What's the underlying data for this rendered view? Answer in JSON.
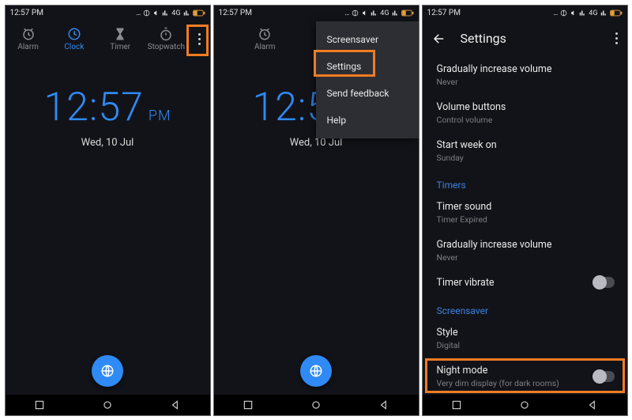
{
  "status": {
    "time": "12:57 PM",
    "net": "4G",
    "extra": "…"
  },
  "tabs": {
    "alarm": "Alarm",
    "clock": "Clock",
    "timer": "Timer",
    "stopwatch": "Stopwatch"
  },
  "clock": {
    "time": "12:57",
    "ampm": "PM",
    "date": "Wed, 10 Jul"
  },
  "menu": {
    "screensaver": "Screensaver",
    "settings": "Settings",
    "feedback": "Send feedback",
    "help": "Help"
  },
  "settings": {
    "title": "Settings",
    "giv": {
      "t": "Gradually increase volume",
      "s": "Never"
    },
    "vol": {
      "t": "Volume buttons",
      "s": "Control volume"
    },
    "week": {
      "t": "Start week on",
      "s": "Sunday"
    },
    "sec_timers": "Timers",
    "tsound": {
      "t": "Timer sound",
      "s": "Timer Expired"
    },
    "giv2": {
      "t": "Gradually increase volume",
      "s": "Never"
    },
    "tvib": {
      "t": "Timer vibrate"
    },
    "sec_ss": "Screensaver",
    "style": {
      "t": "Style",
      "s": "Digital"
    },
    "night": {
      "t": "Night mode",
      "s": "Very dim display (for dark rooms)"
    }
  }
}
